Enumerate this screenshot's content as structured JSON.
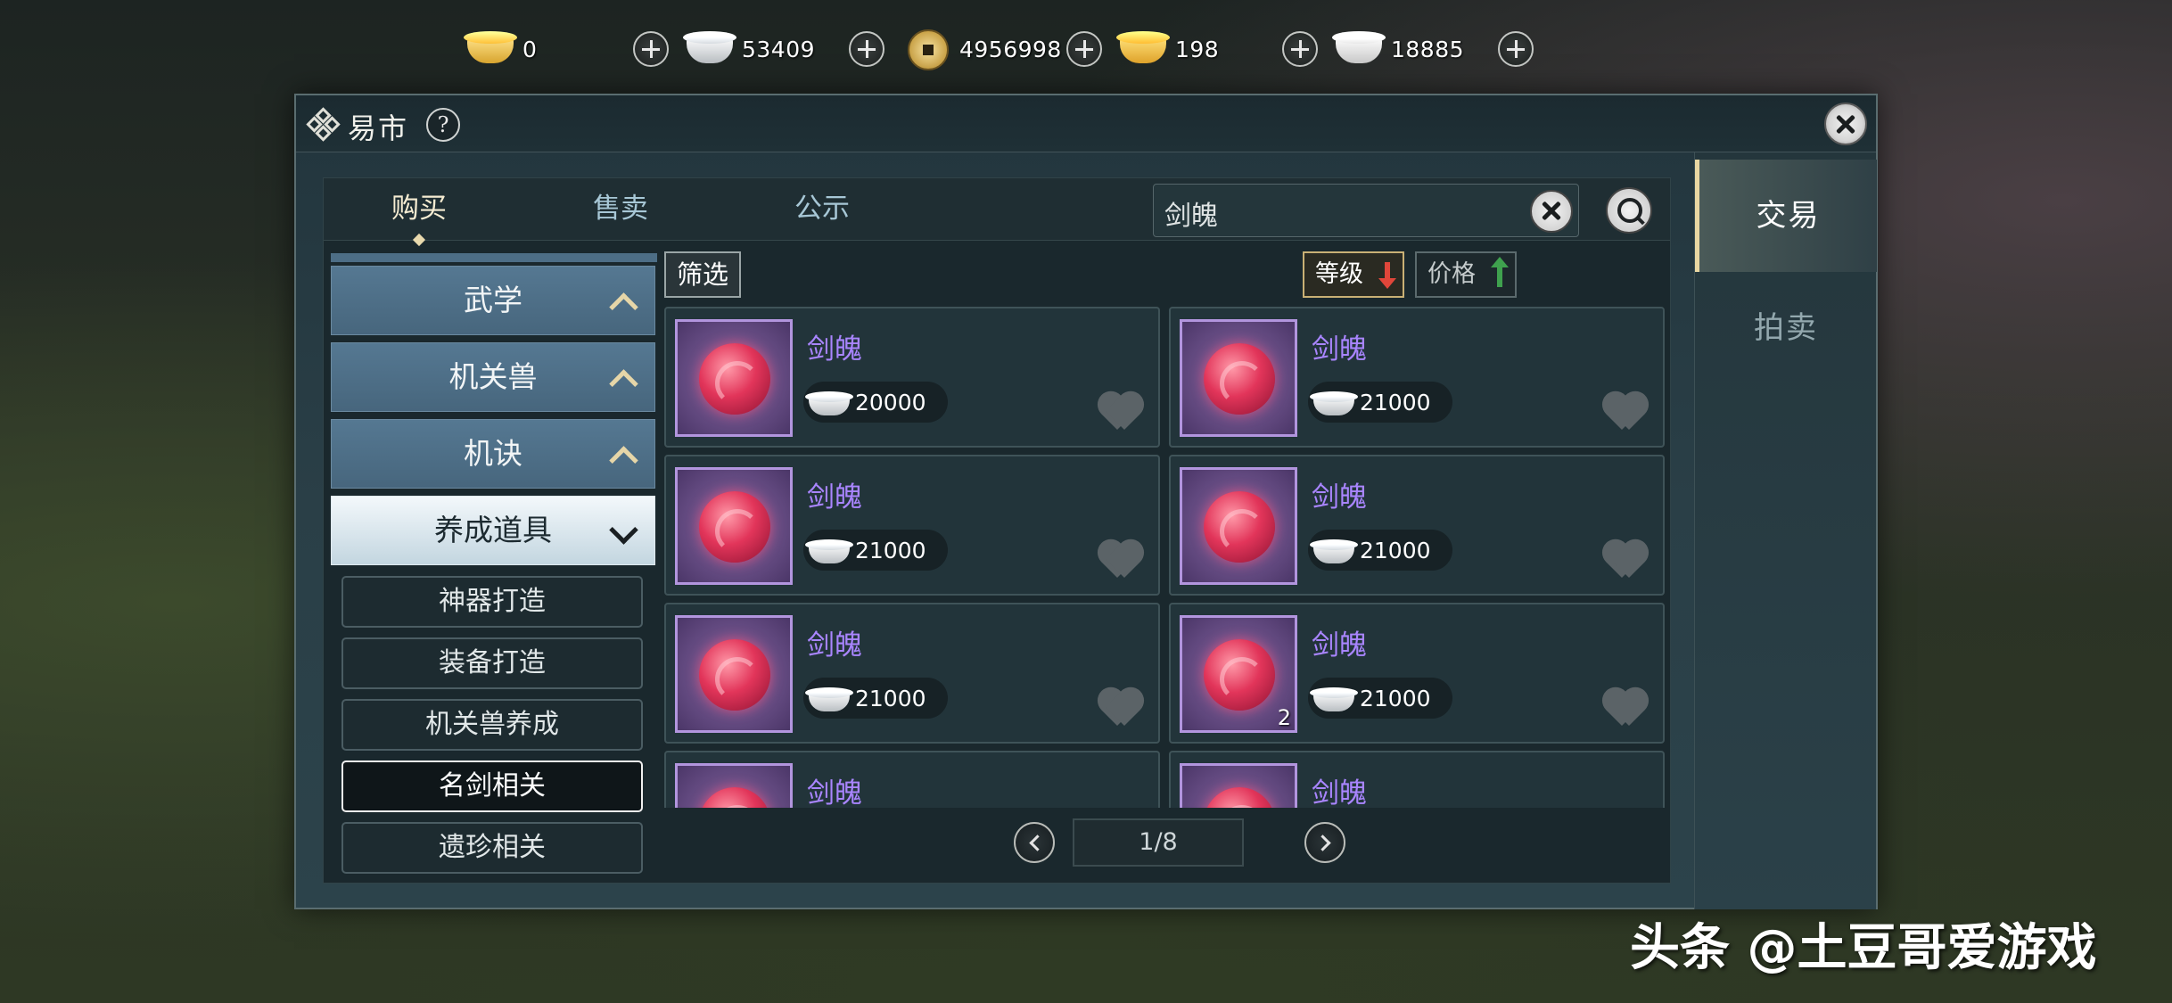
{
  "currencies": [
    {
      "icon": "gold-ingot-icon",
      "value": "0"
    },
    {
      "icon": "silver-ingot-icon",
      "value": "53409"
    },
    {
      "icon": "copper-coin-icon",
      "value": "4956998"
    },
    {
      "icon": "gold-shard-icon",
      "value": "198"
    },
    {
      "icon": "silver-shard-icon",
      "value": "18885"
    }
  ],
  "window": {
    "title": "易市",
    "help_label": "?"
  },
  "side_tabs": [
    "交易",
    "拍卖"
  ],
  "top_tabs": [
    "购买",
    "售卖",
    "公示"
  ],
  "search": {
    "value": "剑魄"
  },
  "categories": [
    {
      "label": "武学"
    },
    {
      "label": "机关兽"
    },
    {
      "label": "机诀"
    },
    {
      "label": "养成道具"
    }
  ],
  "subcategories": [
    "神器打造",
    "装备打造",
    "机关兽养成",
    "名剑相关",
    "遗珍相关"
  ],
  "active_subcategory": "名剑相关",
  "filter_label": "筛选",
  "sort": {
    "level_label": "等级",
    "price_label": "价格"
  },
  "items": [
    {
      "name": "剑魄",
      "price": "20000",
      "qty": ""
    },
    {
      "name": "剑魄",
      "price": "21000",
      "qty": ""
    },
    {
      "name": "剑魄",
      "price": "21000",
      "qty": ""
    },
    {
      "name": "剑魄",
      "price": "21000",
      "qty": ""
    },
    {
      "name": "剑魄",
      "price": "21000",
      "qty": ""
    },
    {
      "name": "剑魄",
      "price": "21000",
      "qty": "2"
    },
    {
      "name": "剑魄",
      "price": "",
      "qty": ""
    },
    {
      "name": "剑魄",
      "price": "",
      "qty": ""
    }
  ],
  "pagination": {
    "label": "1/8"
  },
  "watermark": "头条 @土豆哥爱游戏",
  "colors": {
    "accent_gold": "#e9d7a2",
    "item_name": "#a985ff",
    "sort_down": "#e0463a",
    "sort_up": "#3fa14e"
  }
}
